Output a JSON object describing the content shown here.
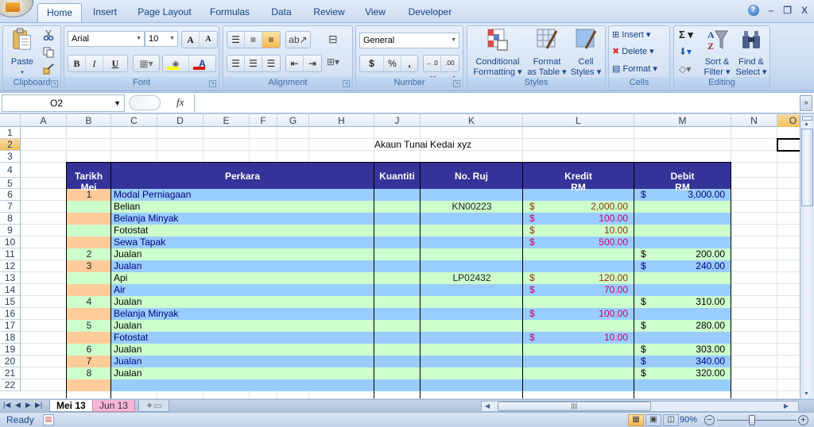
{
  "app": {
    "office_button": "Office Button"
  },
  "ribbon_tabs": [
    {
      "label": "Home",
      "active": true
    },
    {
      "label": "Insert"
    },
    {
      "label": "Page Layout"
    },
    {
      "label": "Formulas"
    },
    {
      "label": "Data"
    },
    {
      "label": "Review"
    },
    {
      "label": "View"
    },
    {
      "label": "Developer"
    }
  ],
  "window_controls": {
    "help": "?",
    "minimize": "–",
    "restore": "❐",
    "close": "X"
  },
  "ribbon": {
    "clipboard": {
      "label": "Clipboard",
      "paste": "Paste"
    },
    "font": {
      "label": "Font",
      "font_name": "Arial",
      "font_size": "10",
      "grow": "A",
      "shrink": "A",
      "bold": "B",
      "italic": "I",
      "underline": "U",
      "fill_color": "#ffff00",
      "font_color": "#e01010"
    },
    "alignment": {
      "label": "Alignment"
    },
    "number": {
      "label": "Number",
      "format": "General",
      "currency": "$",
      "percent": "%",
      "comma": ",",
      "inc_decimal": "←.0 .00",
      "dec_decimal": ".00 →.0"
    },
    "styles": {
      "label": "Styles",
      "conditional_formatting": [
        "Conditional",
        "Formatting ▾"
      ],
      "format_as_table": [
        "Format",
        "as Table ▾"
      ],
      "cell_styles": [
        "Cell",
        "Styles ▾"
      ]
    },
    "cells": {
      "label": "Cells",
      "insert": "Insert ▾",
      "delete": "Delete ▾",
      "format": "Format ▾"
    },
    "editing": {
      "label": "Editing",
      "autosum": "Σ ▾",
      "sort_filter": [
        "Sort &",
        "Filter ▾"
      ],
      "find_select": [
        "Find &",
        "Select ▾"
      ]
    }
  },
  "formula_bar": {
    "name_box": "O2",
    "fx": "fx",
    "formula": ""
  },
  "columns": [
    "A",
    "B",
    "C",
    "D",
    "E",
    "F",
    "G",
    "H",
    "J",
    "K",
    "L",
    "M",
    "N",
    "O"
  ],
  "selected_column": "O",
  "selected_row": "2",
  "rows": [
    "1",
    "2",
    "3",
    "4",
    "5",
    "6",
    "7",
    "8",
    "9",
    "10",
    "11",
    "12",
    "13",
    "14",
    "15",
    "16",
    "17",
    "18",
    "19",
    "20",
    "21",
    "22"
  ],
  "sheet": {
    "title": "Akaun Tunai Kedai xyz",
    "headers": {
      "tarikh": [
        "Tarikh",
        "Mei"
      ],
      "perkara": "Perkara",
      "kuantiti": "Kuantiti",
      "no_ruj": "No. Ruj",
      "kredit": [
        "Kredit",
        "RM"
      ],
      "debit": [
        "Debit",
        "RM"
      ]
    },
    "entries": [
      {
        "row": "6",
        "tarikh": "1",
        "perkara": "Modal Perniagaan",
        "no_ruj": "",
        "kredit": "",
        "debit": "3,000.00"
      },
      {
        "row": "7",
        "tarikh": "",
        "perkara": "Belian",
        "no_ruj": "KN00223",
        "kredit": "2,000.00",
        "debit": ""
      },
      {
        "row": "8",
        "tarikh": "",
        "perkara": "Belanja Minyak",
        "no_ruj": "",
        "kredit": "100.00",
        "debit": ""
      },
      {
        "row": "9",
        "tarikh": "",
        "perkara": "Fotostat",
        "no_ruj": "",
        "kredit": "10.00",
        "debit": ""
      },
      {
        "row": "10",
        "tarikh": "",
        "perkara": "Sewa Tapak",
        "no_ruj": "",
        "kredit": "500.00",
        "debit": ""
      },
      {
        "row": "11",
        "tarikh": "2",
        "perkara": "Jualan",
        "no_ruj": "",
        "kredit": "",
        "debit": "200.00"
      },
      {
        "row": "12",
        "tarikh": "3",
        "perkara": "Jualan",
        "no_ruj": "",
        "kredit": "",
        "debit": "240.00"
      },
      {
        "row": "13",
        "tarikh": "",
        "perkara": "Api",
        "no_ruj": "LP02432",
        "kredit": "120.00",
        "debit": ""
      },
      {
        "row": "14",
        "tarikh": "",
        "perkara": "Air",
        "no_ruj": "",
        "kredit": "70.00",
        "debit": ""
      },
      {
        "row": "15",
        "tarikh": "4",
        "perkara": "Jualan",
        "no_ruj": "",
        "kredit": "",
        "debit": "310.00"
      },
      {
        "row": "16",
        "tarikh": "",
        "perkara": "Belanja Minyak",
        "no_ruj": "",
        "kredit": "100.00",
        "debit": ""
      },
      {
        "row": "17",
        "tarikh": "5",
        "perkara": "Jualan",
        "no_ruj": "",
        "kredit": "",
        "debit": "280.00"
      },
      {
        "row": "18",
        "tarikh": "",
        "perkara": "Fotostat",
        "no_ruj": "",
        "kredit": "10.00",
        "debit": ""
      },
      {
        "row": "19",
        "tarikh": "6",
        "perkara": "Jualan",
        "no_ruj": "",
        "kredit": "",
        "debit": "303.00"
      },
      {
        "row": "20",
        "tarikh": "7",
        "perkara": "Jualan",
        "no_ruj": "",
        "kredit": "",
        "debit": "340.00"
      },
      {
        "row": "21",
        "tarikh": "8",
        "perkara": "Jualan",
        "no_ruj": "",
        "kredit": "",
        "debit": "320.00"
      },
      {
        "row": "22",
        "tarikh": "",
        "perkara": "",
        "no_ruj": "",
        "kredit": "",
        "debit": ""
      }
    ],
    "currency_symbol": "$",
    "colors": {
      "header_bg": "#333399",
      "band_green": "#ccffcc",
      "band_blue": "#99ccff",
      "tarikh_orange": "#ffcc99",
      "kredit_text": "#cc0066",
      "kredit_text_alt": "#993300",
      "text_dark_blue": "#000080"
    }
  },
  "sheet_tabs": [
    {
      "label": "Mei 13",
      "active": true
    },
    {
      "label": "Jun 13",
      "active": false
    }
  ],
  "status": {
    "text": "Ready",
    "zoom": "90%",
    "zoom_level_percent": 90
  }
}
